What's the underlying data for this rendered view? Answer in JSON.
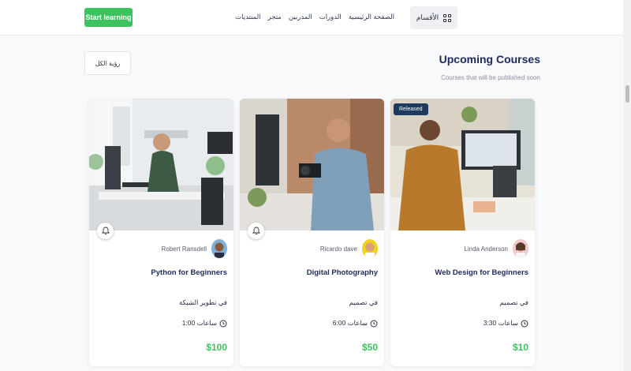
{
  "header": {
    "start_button": "Start learning",
    "nav": [
      "الصفحة الرئيسية",
      "الدورات",
      "المدربين",
      "متجر",
      "المنتديات"
    ],
    "categories_label": "الأقسام"
  },
  "section": {
    "title": "Upcoming Courses",
    "subtitle": "Courses that will be published soon",
    "view_all": "رؤية الكل"
  },
  "courses": [
    {
      "badge": "",
      "author": "Robert Ransdell",
      "title": "Python for Beginners",
      "category": "في تطوير الشبكة",
      "duration": "1:00 ساعات",
      "price": "$100"
    },
    {
      "badge": "",
      "author": "Ricardo dave",
      "title": "Digital Photography",
      "category": "في تصميم",
      "duration": "6:00 ساعات",
      "price": "$50"
    },
    {
      "badge": "Released",
      "author": "Linda Anderson",
      "title": "Web Design for Beginners",
      "category": "في تصميم",
      "duration": "3:30 ساعات",
      "price": "$10"
    }
  ],
  "colors": {
    "accent_green": "#3cc25f",
    "title_navy": "#1f2a5c",
    "badge_navy": "#1e3a5f"
  }
}
